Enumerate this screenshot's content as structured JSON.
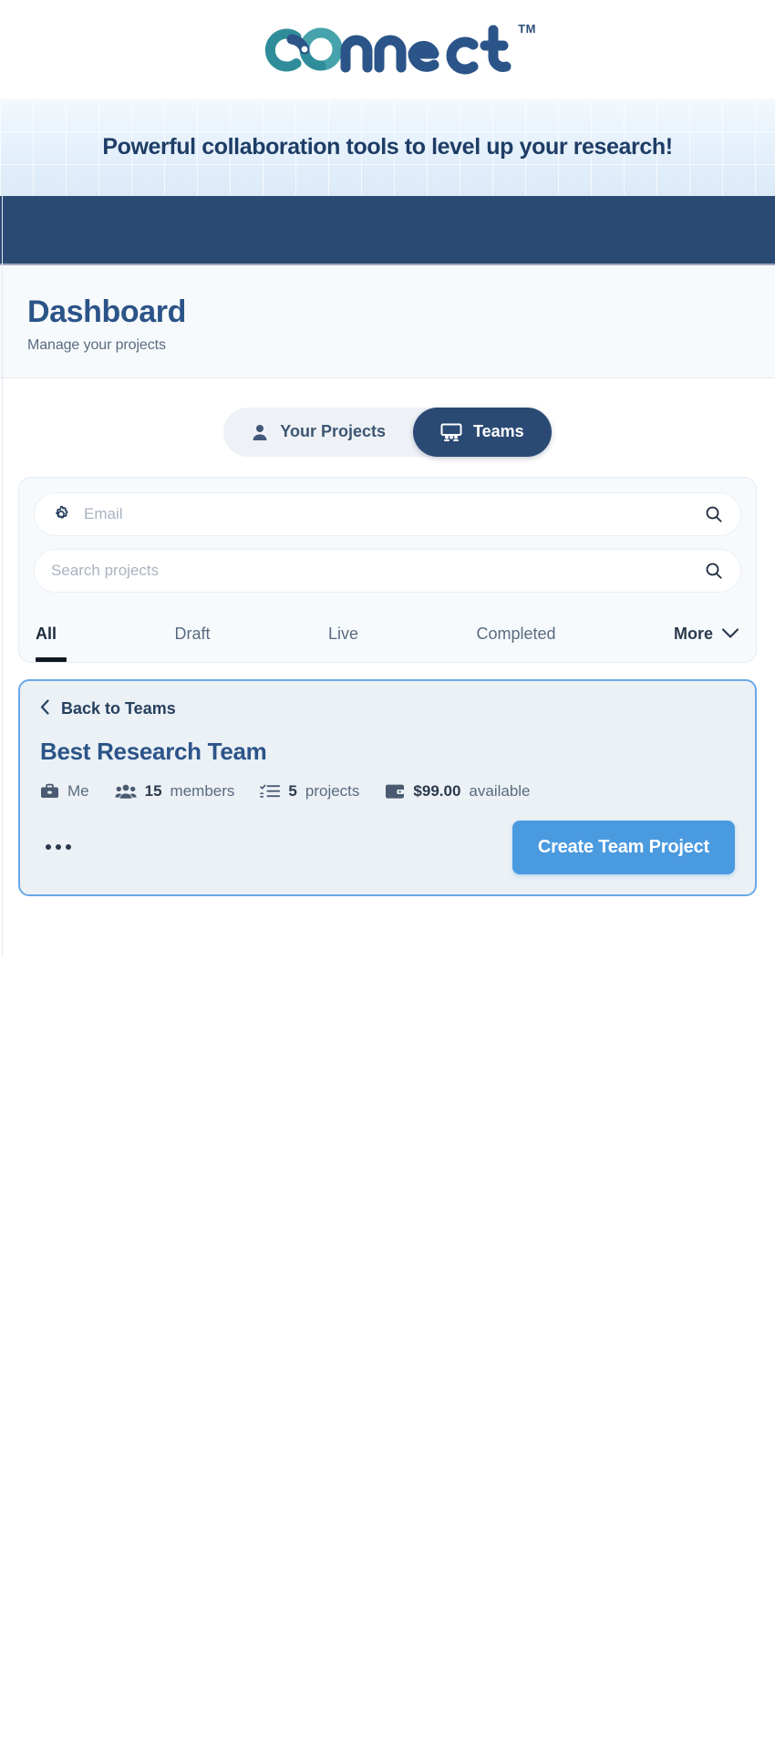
{
  "brand": {
    "logo_text": "connect",
    "trademark": "TM",
    "logo_color_teal": "#3a9aa4",
    "logo_color_navy": "#2b5488"
  },
  "banner": {
    "tagline": "Powerful collaboration tools to level up your research!"
  },
  "dashboard": {
    "title": "Dashboard",
    "subtitle": "Manage your projects"
  },
  "toggle": {
    "your_projects": {
      "label": "Your Projects",
      "icon": "user-icon",
      "active": false
    },
    "teams": {
      "label": "Teams",
      "icon": "teams-icon",
      "active": true
    }
  },
  "filters": {
    "email_field": {
      "placeholder": "Email",
      "value": "",
      "left_icon": "gear-icon",
      "right_icon": "search-icon"
    },
    "search_field": {
      "placeholder": "Search projects",
      "value": "",
      "right_icon": "search-icon"
    },
    "tabs": [
      {
        "label": "All",
        "active": true
      },
      {
        "label": "Draft",
        "active": false
      },
      {
        "label": "Live",
        "active": false
      },
      {
        "label": "Completed",
        "active": false
      }
    ],
    "more_label": "More",
    "more_icon": "chevron-down-icon"
  },
  "team_card": {
    "back_label": "Back to Teams",
    "back_icon": "chevron-left-icon",
    "team_name": "Best Research Team",
    "meta": [
      {
        "icon": "briefcase-icon",
        "value": "",
        "label": "Me"
      },
      {
        "icon": "users-icon",
        "value": "15",
        "label": "members"
      },
      {
        "icon": "tasks-list-icon",
        "value": "5",
        "label": "projects"
      },
      {
        "icon": "wallet-icon",
        "value": "$99.00",
        "label": "available"
      }
    ],
    "overflow_icon": "ellipsis-icon",
    "create_button": "Create Team Project",
    "accent_border": "#69a9e8",
    "button_color": "#4a9ae0"
  }
}
